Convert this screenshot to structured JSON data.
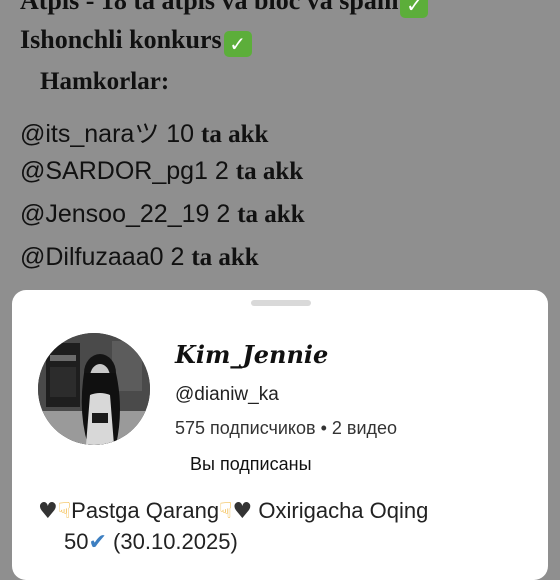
{
  "background_post": {
    "line0": "Atpis - 18 ta atpis va bloc va spam",
    "line1": "Ishonchli konkurs",
    "line2": "Hamkorlar:",
    "partners": [
      {
        "handle": "@its_naraツ 10",
        "amount": "ta  akk"
      },
      {
        "handle": "@SARDOR_pg1 2",
        "amount": "ta akk"
      },
      {
        "handle": "@Jensoo_22_19 2",
        "amount": "ta akk"
      },
      {
        "handle": "@Dilfuzaaa0 2",
        "amount": "ta akk"
      }
    ]
  },
  "channel_sheet": {
    "name": "𝓚𝓲𝓶_𝓙𝓮𝓷𝓷𝓲𝓮",
    "name_plain": "Kim_Jennie",
    "handle": "@dianiw_ka",
    "stats": "575 подписчиков • 2 видео",
    "subscribe_state": "Вы подписаны",
    "description_line1_a": "Pastga Qarang",
    "description_line1_b": "Oxirigacha Oqing",
    "description_line2_a": "50",
    "description_line2_b": "(30.10.2025)"
  },
  "icons": {
    "check": "green-check-icon",
    "heart": "black-heart-icon",
    "pointer": "pointing-down-icon",
    "tick": "blue-check-icon"
  }
}
